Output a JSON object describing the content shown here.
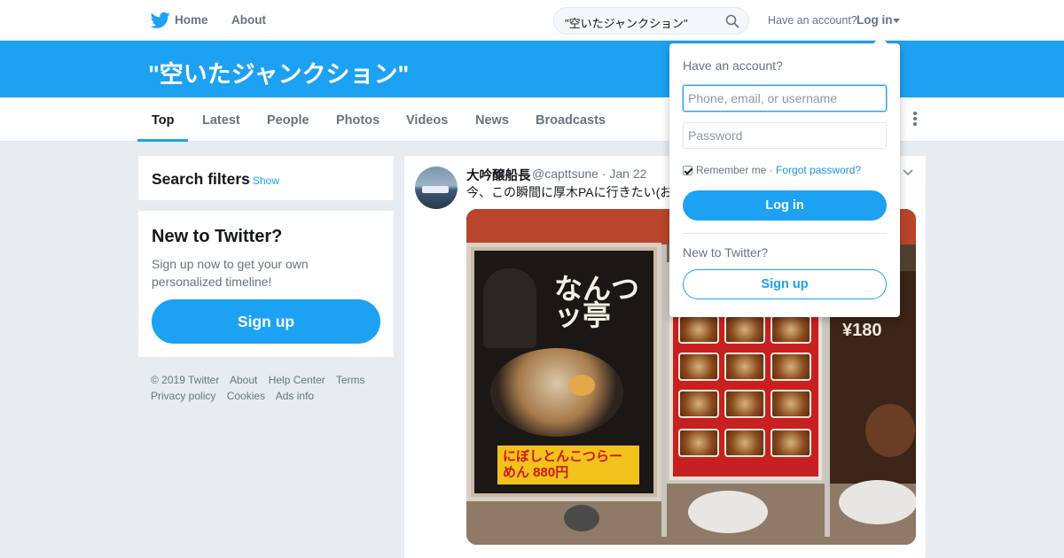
{
  "nav": {
    "home_label": "Home",
    "about_label": "About",
    "logo_icon": "twitter-bird-icon",
    "brand_color": "#1da1f2"
  },
  "search": {
    "query": "\"空いたジャンクション\"",
    "icon": "search-icon"
  },
  "account": {
    "prompt": "Have an account?",
    "login_label": "Log in"
  },
  "header": {
    "title": "\"空いたジャンクション\""
  },
  "tabs": [
    {
      "label": "Top",
      "active": true
    },
    {
      "label": "Latest"
    },
    {
      "label": "People"
    },
    {
      "label": "Photos"
    },
    {
      "label": "Videos"
    },
    {
      "label": "News"
    },
    {
      "label": "Broadcasts"
    }
  ],
  "filters": {
    "title": "Search filters",
    "separator": "·",
    "show_label": "Show"
  },
  "new_to_twitter": {
    "title": "New to Twitter?",
    "description": "Sign up now to get your own personalized timeline!",
    "signup_label": "Sign up"
  },
  "footer": {
    "links": [
      "© 2019 Twitter",
      "About",
      "Help Center",
      "Terms",
      "Privacy policy",
      "Cookies",
      "Ads info"
    ]
  },
  "tweet": {
    "author_name": "大吟醸船長",
    "handle_and_date": "@capttsune · Jan 22",
    "text": "今、この瞬間に厚木PAに行きたい(お",
    "photo_text": {
      "poster_title": "なんつッ亭",
      "poster_label": "にぼしとんこつらーめん 880円",
      "price_sign": "¥180"
    }
  },
  "login_dropdown": {
    "title": "Have an account?",
    "username_placeholder": "Phone, email, or username",
    "password_placeholder": "Password",
    "remember_label": "Remember me",
    "dot": "·",
    "forgot_label": "Forgot password?",
    "login_label": "Log in",
    "new_label": "New to Twitter?",
    "signup_label": "Sign up"
  }
}
